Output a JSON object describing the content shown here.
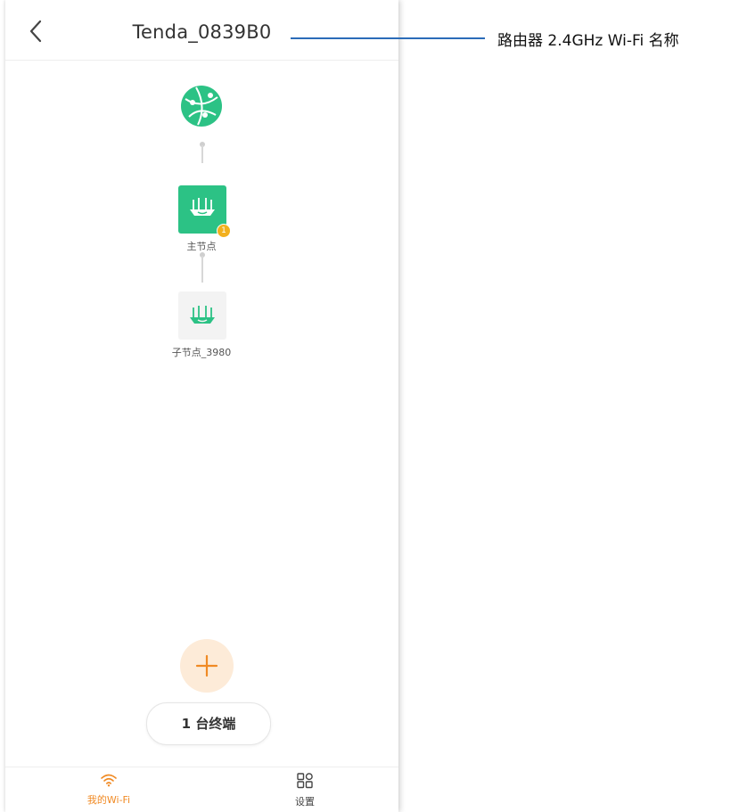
{
  "header": {
    "title": "Tenda_0839B0",
    "back_icon": "chevron-left-icon"
  },
  "topology": {
    "internet_icon": "globe-icon",
    "main_node": {
      "label": "主节点",
      "badge": "1",
      "icon": "router-icon"
    },
    "sub_node": {
      "label": "子节点_3980",
      "icon": "router-icon"
    }
  },
  "actions": {
    "add_icon": "plus-icon",
    "terminals_label": "1 台终端"
  },
  "tabbar": {
    "tabs": [
      {
        "label": "我的Wi-Fi",
        "icon": "wifi-icon",
        "active": true
      },
      {
        "label": "设置",
        "icon": "grid-icon",
        "active": false
      }
    ]
  },
  "annotation": {
    "text": "路由器 2.4GHz Wi-Fi 名称"
  },
  "colors": {
    "accent": "#f08a24",
    "node_green": "#2cc285",
    "annotation_line": "#2b6cb8"
  }
}
